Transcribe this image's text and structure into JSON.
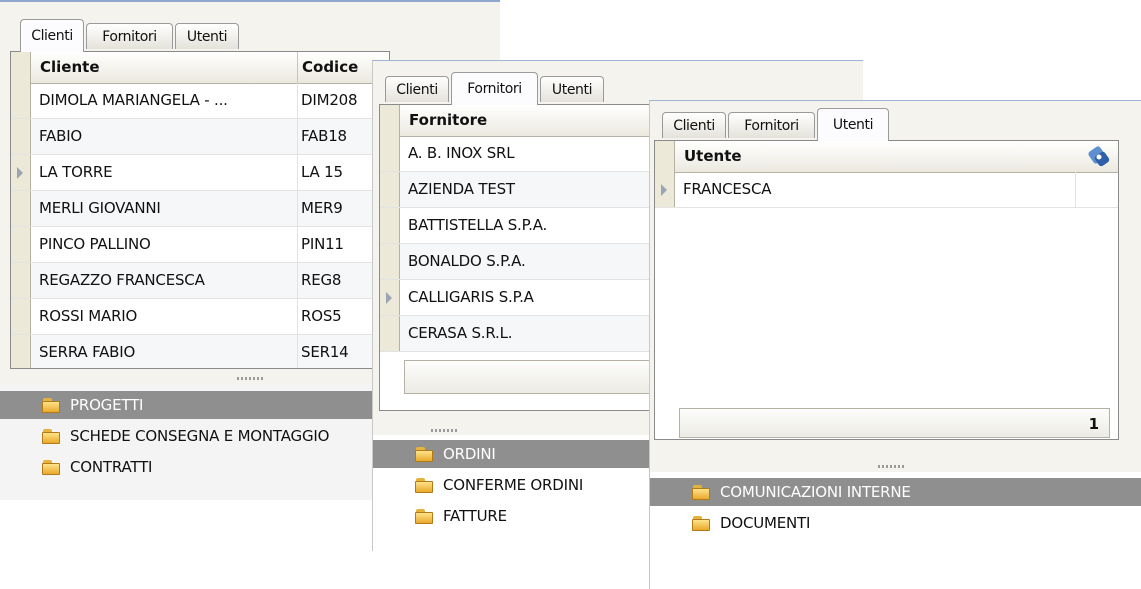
{
  "clienti_window": {
    "tabs": [
      "Clienti",
      "Fornitori",
      "Utenti"
    ],
    "columns": [
      "Cliente",
      "Codice"
    ],
    "rows": [
      {
        "name": "DIMOLA MARIANGELA - ...",
        "code": "DIM208"
      },
      {
        "name": "FABIO",
        "code": "FAB18"
      },
      {
        "name": "LA TORRE",
        "code": "LA 15"
      },
      {
        "name": "MERLI GIOVANNI",
        "code": "MER9"
      },
      {
        "name": "PINCO PALLINO",
        "code": "PIN11"
      },
      {
        "name": "REGAZZO FRANCESCA",
        "code": "REG8"
      },
      {
        "name": "ROSSI MARIO",
        "code": "ROS5"
      },
      {
        "name": "SERRA FABIO",
        "code": "SER14"
      }
    ],
    "current_row": 2,
    "folders": [
      "PROGETTI",
      "SCHEDE CONSEGNA E MONTAGGIO",
      "CONTRATTI"
    ],
    "selected_folder": 0
  },
  "fornitori_window": {
    "tabs": [
      "Clienti",
      "Fornitori",
      "Utenti"
    ],
    "columns": [
      "Fornitore"
    ],
    "rows": [
      {
        "name": "A. B. INOX SRL"
      },
      {
        "name": "AZIENDA TEST"
      },
      {
        "name": "BATTISTELLA S.P.A."
      },
      {
        "name": "BONALDO S.P.A."
      },
      {
        "name": "CALLIGARIS S.P.A"
      },
      {
        "name": "CERASA S.R.L."
      }
    ],
    "current_row": 4,
    "folders": [
      "ORDINI",
      "CONFERME ORDINI",
      "FATTURE"
    ],
    "selected_folder": 0
  },
  "utenti_window": {
    "tabs": [
      "Clienti",
      "Fornitori",
      "Utenti"
    ],
    "columns": [
      "Utente"
    ],
    "rows": [
      {
        "name": "FRANCESCA"
      }
    ],
    "current_row": 0,
    "record_count": "1",
    "folders": [
      "COMUNICAZIONI INTERNE",
      "DOCUMENTI"
    ],
    "selected_folder": 0
  },
  "colors": {
    "selected_folder_bg": "#8f8f8f",
    "grid_header_bg": "#ebe9df",
    "folder_yellow": "#e8a92c"
  },
  "icons": [
    "folder-icon",
    "row-pointer-icon",
    "paperclip-icon",
    "splitter-grip-icon"
  ]
}
